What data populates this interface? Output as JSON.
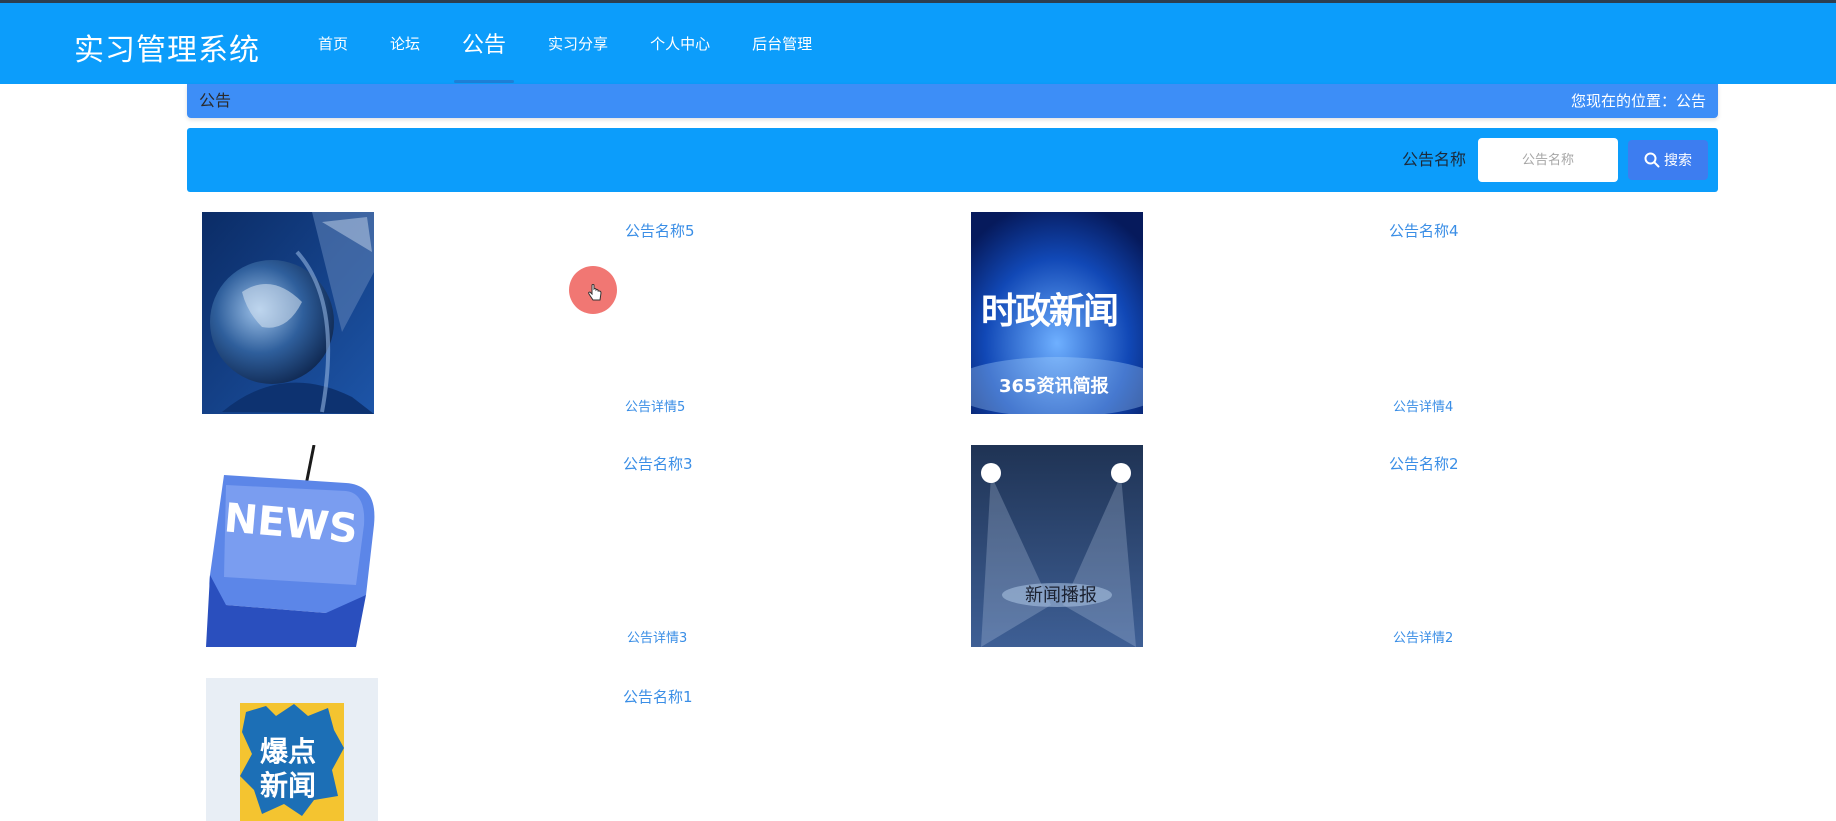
{
  "header": {
    "brand": "实习管理系统",
    "nav": [
      {
        "label": "首页"
      },
      {
        "label": "论坛"
      },
      {
        "label": "公告"
      },
      {
        "label": "实习分享"
      },
      {
        "label": "个人中心"
      },
      {
        "label": "后台管理"
      }
    ]
  },
  "breadcrumb": {
    "title": "公告",
    "location": "您现在的位置：公告"
  },
  "search": {
    "label": "公告名称",
    "placeholder": "公告名称",
    "button_label": "搜索",
    "button_icon": "search-icon"
  },
  "notices": [
    {
      "title": "公告名称5",
      "detail": "公告详情5",
      "image_text": ""
    },
    {
      "title": "公告名称4",
      "detail": "公告详情4",
      "image_text": "时政新闻",
      "image_subtext": "365资讯简报"
    },
    {
      "title": "公告名称3",
      "detail": "公告详情3",
      "image_text": "NEWS"
    },
    {
      "title": "公告名称2",
      "detail": "公告详情2",
      "image_text": "新闻播报"
    },
    {
      "title": "公告名称1",
      "detail": "",
      "image_text": "爆点",
      "image_subtext": "新闻"
    }
  ],
  "colors": {
    "header_bg": "#0c9dfb",
    "crumb_bg": "#3d8ef7",
    "link": "#3a8ee6",
    "cursor_marker": "#ee5f5a"
  }
}
